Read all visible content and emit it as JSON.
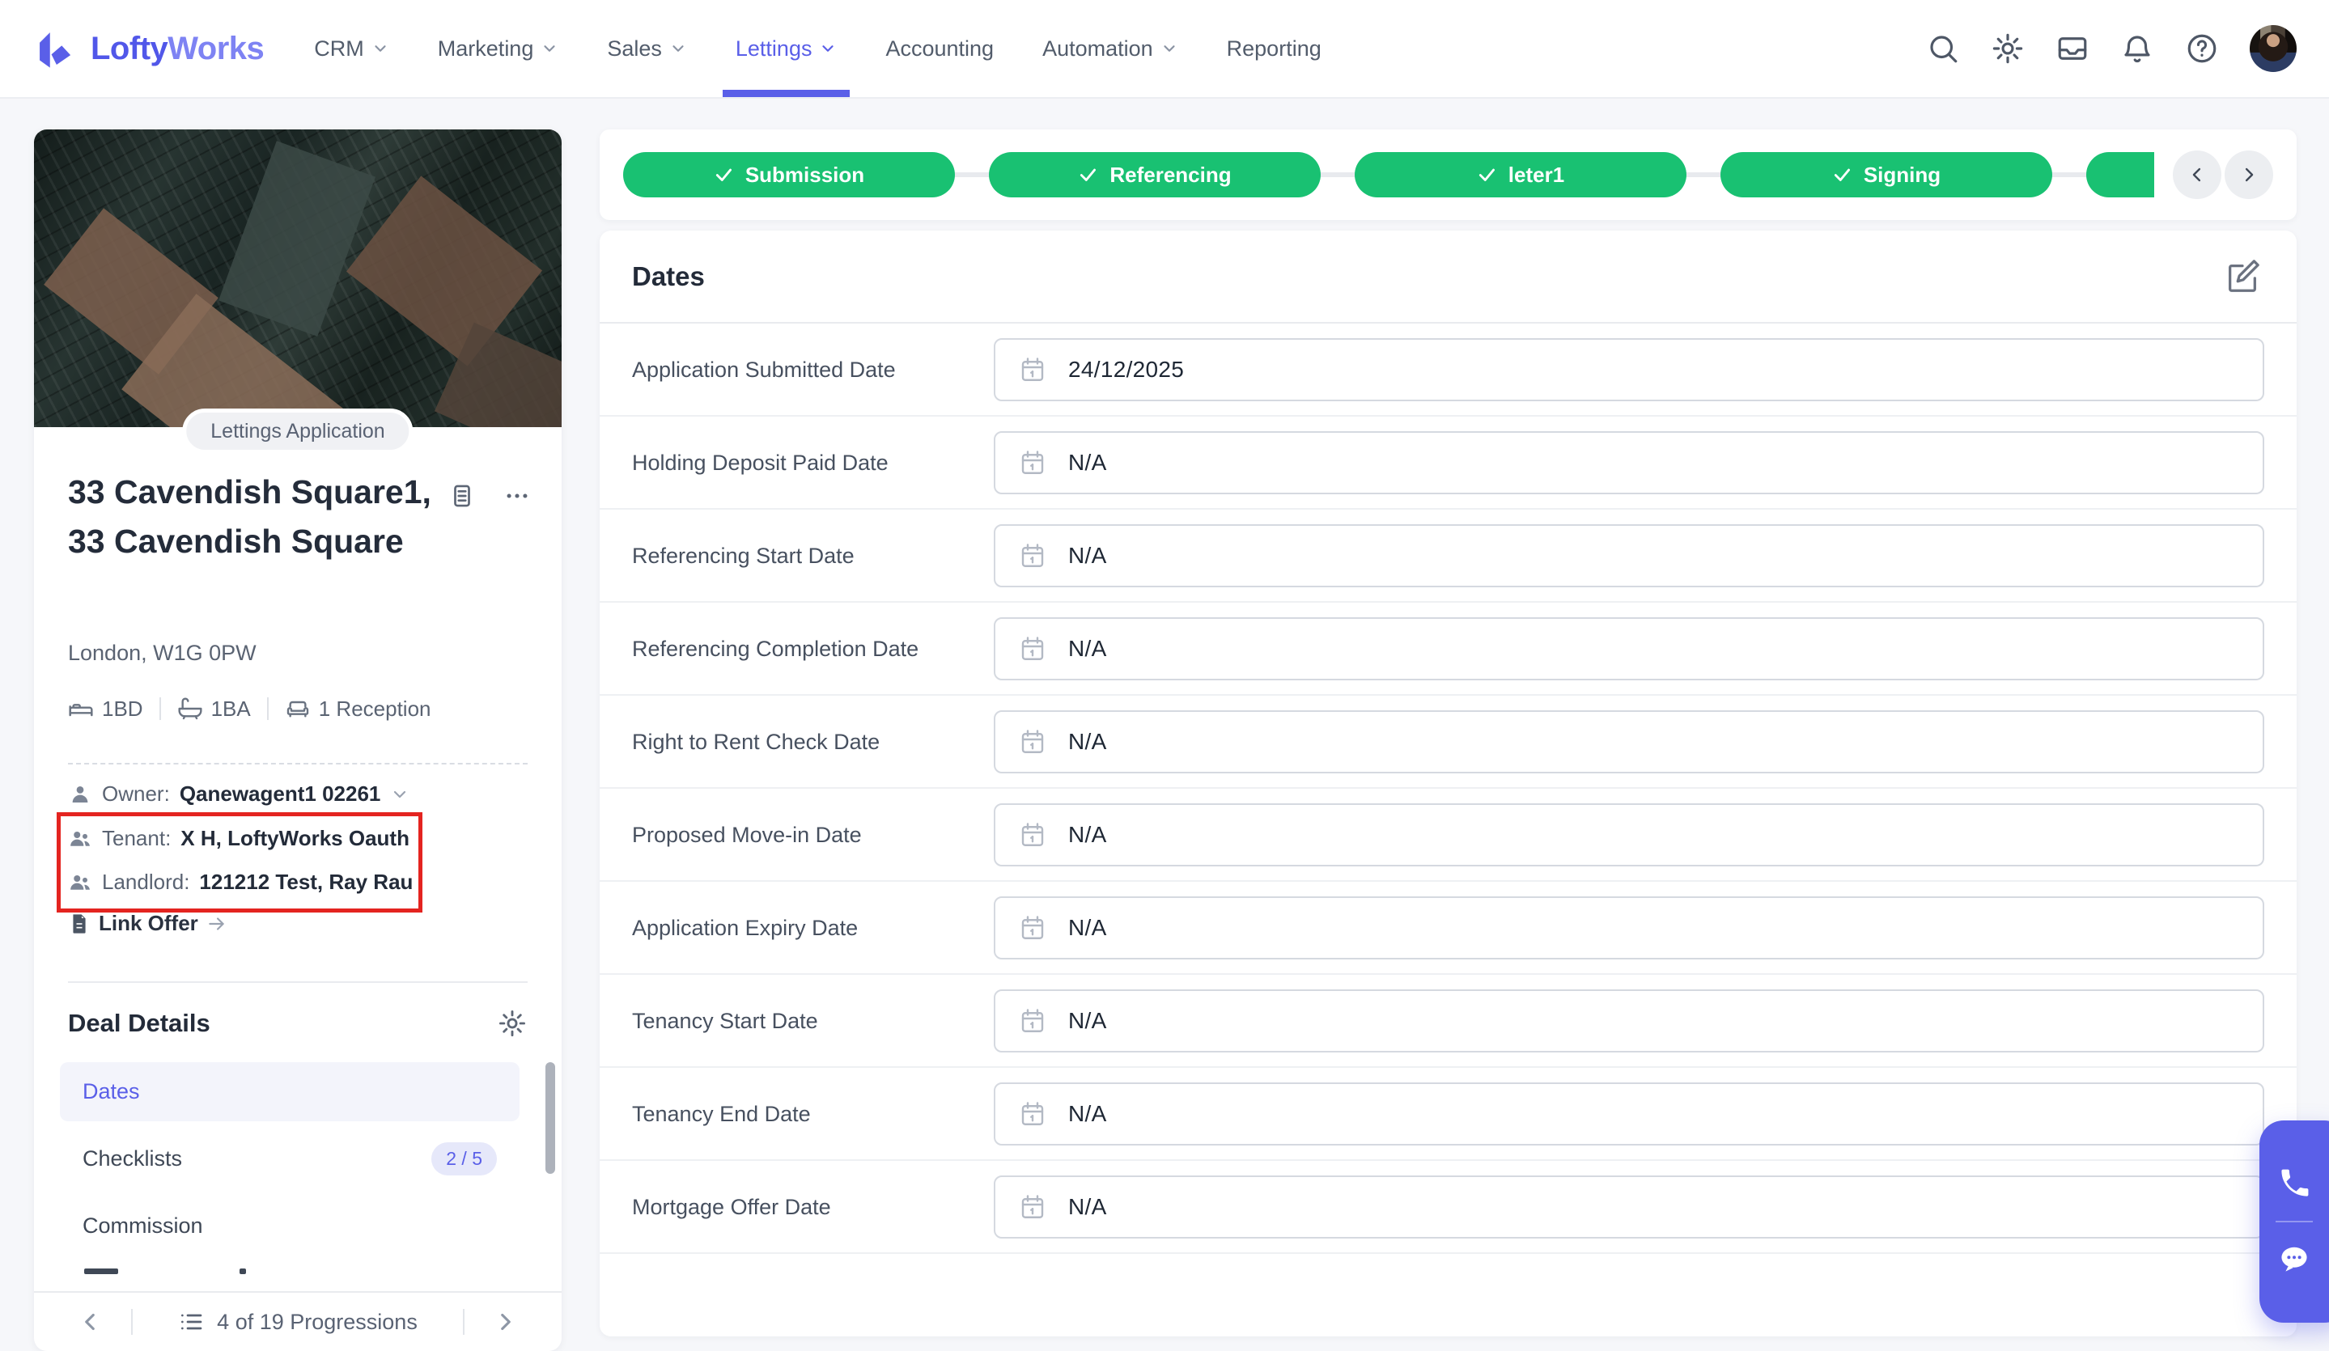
{
  "colors": {
    "accent": "#5a5fe8",
    "step_green": "#19c172",
    "annotation_red": "#e42420"
  },
  "nav": {
    "brand": {
      "first": "Lofty",
      "second": "Works"
    },
    "items": [
      {
        "label": "CRM",
        "has_dropdown": true,
        "active": false
      },
      {
        "label": "Marketing",
        "has_dropdown": true,
        "active": false
      },
      {
        "label": "Sales",
        "has_dropdown": true,
        "active": false
      },
      {
        "label": "Lettings",
        "has_dropdown": true,
        "active": true
      },
      {
        "label": "Accounting",
        "has_dropdown": false,
        "active": false
      },
      {
        "label": "Automation",
        "has_dropdown": true,
        "active": false
      },
      {
        "label": "Reporting",
        "has_dropdown": false,
        "active": false
      }
    ],
    "icons": [
      "search-icon",
      "settings-gear-icon",
      "inbox-icon",
      "notifications-bell-icon",
      "help-icon",
      "user-avatar"
    ]
  },
  "progress": {
    "steps": [
      {
        "label": "Submission",
        "status": "complete"
      },
      {
        "label": "Referencing",
        "status": "complete"
      },
      {
        "label": "leter1",
        "status": "complete"
      },
      {
        "label": "Signing",
        "status": "complete"
      }
    ],
    "partial_next_step_visible": true
  },
  "property": {
    "tag": "Lettings Application",
    "title": "33 Cavendish Square1, 33 Cavendish Square",
    "address": "London, W1G 0PW",
    "stats": [
      {
        "icon": "bed-icon",
        "label": "1BD"
      },
      {
        "icon": "bath-icon",
        "label": "1BA"
      },
      {
        "icon": "sofa-icon",
        "label": "1 Reception"
      }
    ],
    "owner": {
      "label": "Owner:",
      "value": "Qanewagent1 02261"
    },
    "tenant": {
      "label": "Tenant:",
      "value": "X H,  LoftyWorks Oauth"
    },
    "landlord": {
      "label": "Landlord:",
      "value": "121212 Test,  Ray Rau"
    },
    "link_offer": "Link Offer"
  },
  "deal_details": {
    "title": "Deal Details",
    "items": [
      {
        "label": "Dates",
        "active": true
      },
      {
        "label": "Checklists",
        "badge": "2 / 5"
      },
      {
        "label": "Commission"
      }
    ],
    "pagination": "4 of 19 Progressions"
  },
  "dates_panel": {
    "title": "Dates",
    "fields": [
      {
        "label": "Application Submitted Date",
        "value": "24/12/2025"
      },
      {
        "label": "Holding Deposit Paid Date",
        "value": "N/A"
      },
      {
        "label": "Referencing Start Date",
        "value": "N/A"
      },
      {
        "label": "Referencing Completion Date",
        "value": "N/A"
      },
      {
        "label": "Right to Rent Check Date",
        "value": "N/A"
      },
      {
        "label": "Proposed Move-in Date",
        "value": "N/A"
      },
      {
        "label": "Application Expiry Date",
        "value": "N/A"
      },
      {
        "label": "Tenancy Start Date",
        "value": "N/A"
      },
      {
        "label": "Tenancy End Date",
        "value": "N/A"
      },
      {
        "label": "Mortgage Offer Date",
        "value": "N/A"
      }
    ]
  }
}
